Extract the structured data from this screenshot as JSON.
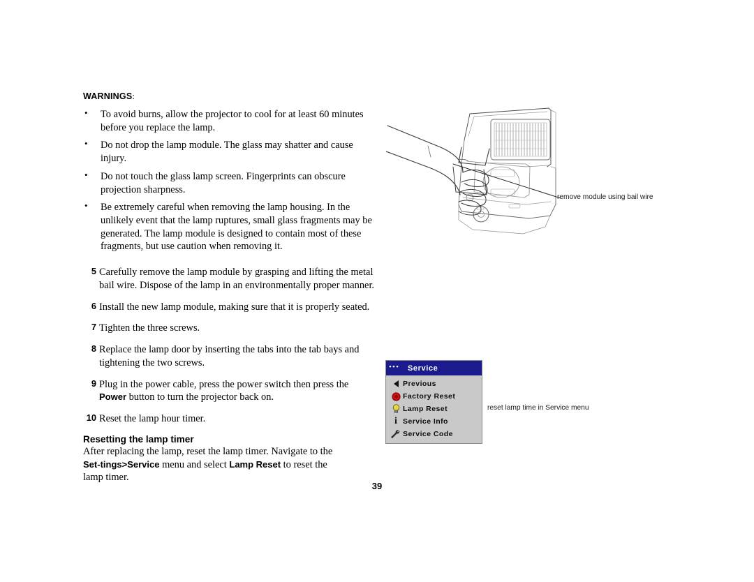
{
  "document": {
    "page_number": "39"
  },
  "warnings": {
    "heading": "WARNINGS",
    "heading_colon": ":",
    "items": [
      "To avoid burns, allow the projector to cool for at least 60 minutes before you replace the lamp.",
      "Do not drop the lamp module. The glass may shatter and cause injury.",
      "Do not touch the glass lamp screen. Fingerprints can obscure projection sharpness.",
      "Be extremely careful when removing the lamp housing. In the unlikely event that the lamp ruptures, small glass fragments may be generated. The lamp module is designed to contain most of these fragments, but use caution when removing it."
    ],
    "bullet_glyph": "•"
  },
  "steps": [
    {
      "number": "5",
      "text": "Carefully remove the lamp module by grasping and lifting the metal bail wire. Dispose of the lamp in an environmentally proper manner."
    },
    {
      "number": "6",
      "text": "Install the new lamp module, making sure that it is properly seated."
    },
    {
      "number": "7",
      "text": "Tighten the three screws."
    },
    {
      "number": "8",
      "text": "Replace the lamp door by inserting the tabs into the tab bays and tightening the two screws."
    },
    {
      "number": "9",
      "text_before": "Plug in the power cable, press the power switch then press the ",
      "bold_term": "Power",
      "text_after": " button to turn the projector back on."
    },
    {
      "number": "10",
      "text": "Reset the lamp hour timer."
    }
  ],
  "reset_section": {
    "heading": "Resetting the lamp timer",
    "para_1": "After replacing the lamp, reset the lamp timer. Navigate to the ",
    "bold_1": "Set-",
    "bold_2": "tings>Service",
    "para_2": " menu and select ",
    "bold_3": "Lamp Reset",
    "para_3": " to reset the lamp timer."
  },
  "callouts": {
    "lamp_module": "remove module using bail wire",
    "service_menu": "reset lamp time in Service menu"
  },
  "service_menu": {
    "title": "Service",
    "title_dots": "•••",
    "title_bg": "#1b1b8e",
    "body_bg": "#c9c9c9",
    "items": [
      {
        "label": "Previous",
        "icon": "triangle-left-icon"
      },
      {
        "label": "Factory Reset",
        "icon": "red-sphere-icon",
        "color": "#cc1111"
      },
      {
        "label": "Lamp Reset",
        "icon": "lightbulb-icon",
        "color": "#e8d43c"
      },
      {
        "label": "Service Info",
        "icon": "info-i-icon"
      },
      {
        "label": "Service Code",
        "icon": "wrench-icon"
      }
    ]
  },
  "illustration": {
    "name": "projector-lamp-removal-line-art",
    "description": "Line drawing of a hand grasping the bail wire of a lamp module inside an open projector"
  }
}
